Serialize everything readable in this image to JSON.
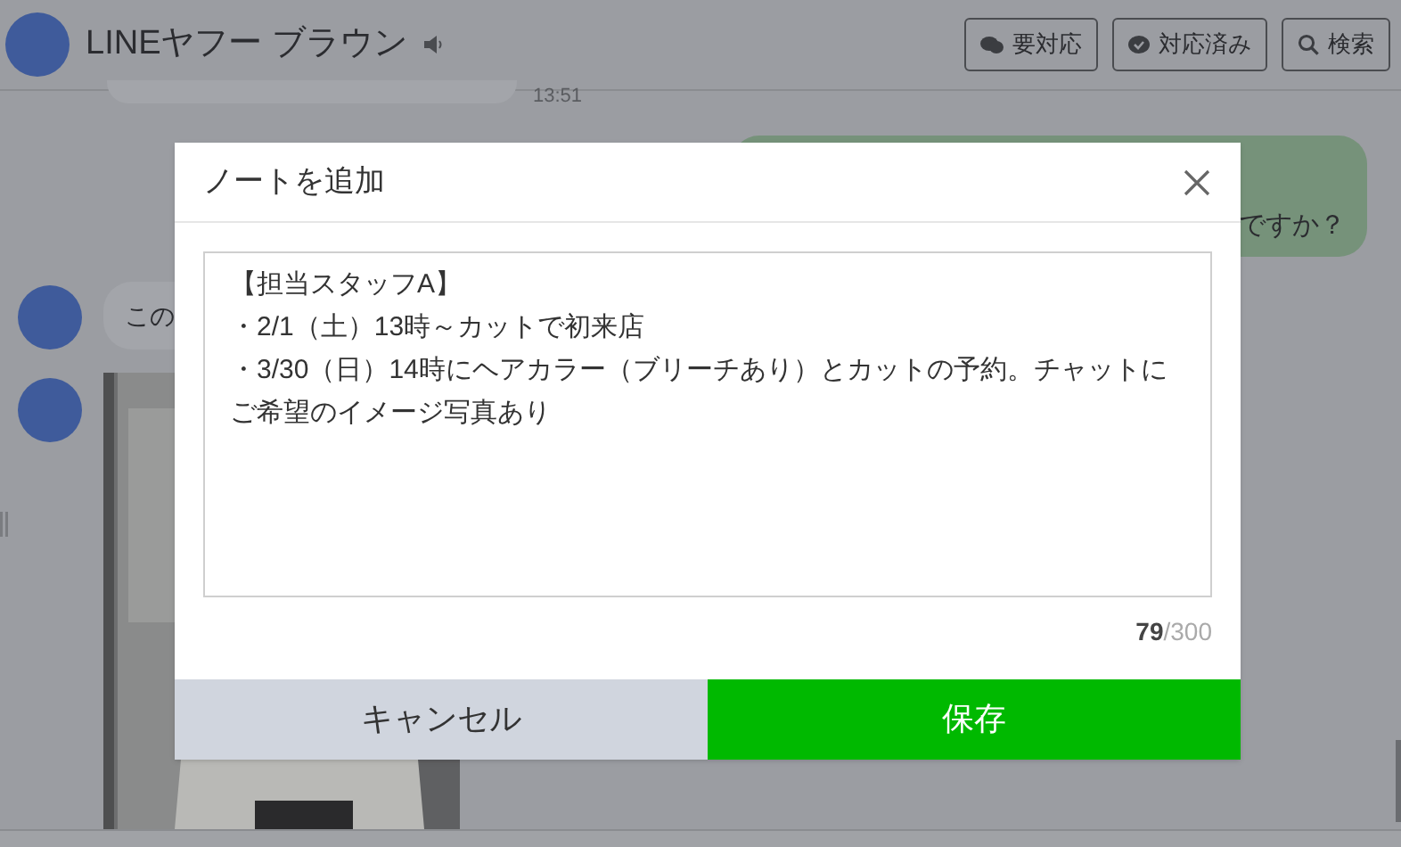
{
  "header": {
    "name": "LINEヤフー ブラウン",
    "buttons": [
      {
        "kind": "bubble",
        "label": "要対応"
      },
      {
        "kind": "check",
        "label": "対応済み"
      },
      {
        "kind": "search",
        "label": "検索"
      }
    ]
  },
  "chat": {
    "time": "13:51",
    "outgoing_text": "ですか？",
    "incoming_text": "この"
  },
  "dialog": {
    "title": "ノートを追加",
    "note_lines": [
      "【担当スタッフA】",
      "・2/1（土）13時～カットで初来店",
      "・3/30（日）14時にヘアカラー（ブリーチあり）とカットの予約。チャットにご希望のイメージ写真あり"
    ],
    "count": "79",
    "limit": "/300",
    "buttons": [
      {
        "kind": "secondary",
        "label": "キャンセル"
      },
      {
        "kind": "primary",
        "label": "保存"
      }
    ]
  }
}
